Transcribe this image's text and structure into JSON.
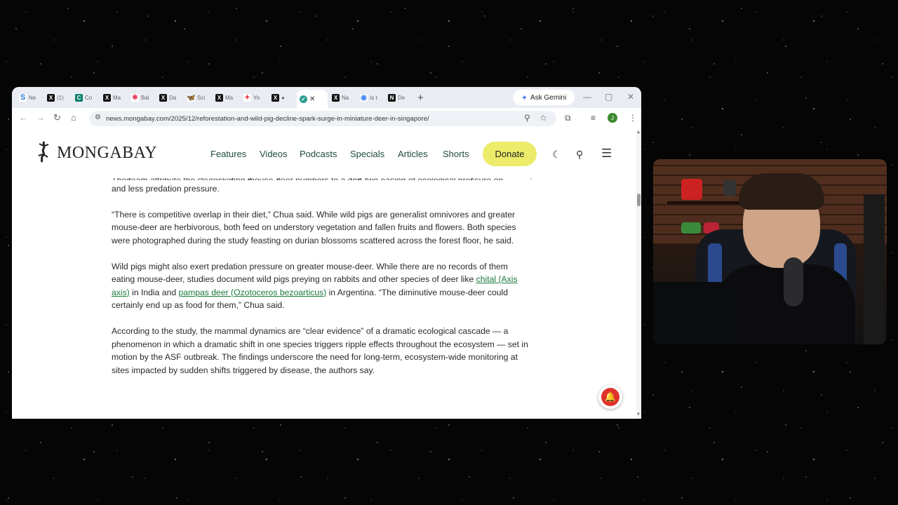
{
  "tabs": [
    {
      "icon": "s",
      "title": "Ne"
    },
    {
      "icon": "x",
      "title": "(1)"
    },
    {
      "icon": "c",
      "title": "Co"
    },
    {
      "icon": "x",
      "title": "Ma"
    },
    {
      "icon": "b",
      "title": "Bal"
    },
    {
      "icon": "x",
      "title": "Da"
    },
    {
      "icon": "bf",
      "title": "Sci"
    },
    {
      "icon": "x",
      "title": "Ma"
    },
    {
      "icon": "g",
      "title": "Yo"
    },
    {
      "icon": "x",
      "title": ""
    },
    {
      "icon": "m",
      "title": ""
    },
    {
      "icon": "x",
      "title": "Na"
    },
    {
      "icon": "ch",
      "title": "Is t"
    },
    {
      "icon": "n",
      "title": "De"
    }
  ],
  "browser": {
    "ask_gemini": "Ask Gemini",
    "url": "news.mongabay.com/2025/12/reforestation-and-wild-pig-decline-spark-surge-in-miniature-deer-in-singapore/",
    "profile_initial": "J"
  },
  "site": {
    "logo": "MONGABAY",
    "nav": [
      "Features",
      "Videos",
      "Podcasts",
      "Specials",
      "Articles",
      "Shorts"
    ],
    "donate": "Donate"
  },
  "article": {
    "cut_line": "The team attribute the skyrocketing mouse-deer numbers to a one-two easing of ecological pressure on",
    "p1": "the greater mouse-deer, the only ungulate species besides the pigs on the island: reduced competition for food, and less predation pressure.",
    "p2": "“There is competitive overlap in their diet,” Chua said. While wild pigs are generalist omnivores and greater mouse-deer are herbivorous, both feed on understory vegetation and fallen fruits and flowers. Both species were photographed during the study feasting on durian blossoms scattered across the forest floor, he said.",
    "p3_a": "Wild pigs might also exert predation pressure on greater mouse-deer. While there are no records of them eating mouse-deer, studies document wild pigs preying on rabbits and other species of deer like ",
    "p3_link1": "chital (Axis axis)",
    "p3_b": " in India and ",
    "p3_link2": "pampas deer (Ozotoceros bezoarticus)",
    "p3_c": " in Argentina. “The diminutive mouse-deer could certainly end up as food for them,” Chua said.",
    "p4": "According to the study, the mammal dynamics are “clear evidence” of a dramatic ecological cascade — a phenomenon in which a dramatic shift in one species triggers ripple effects throughout the ecosystem — set in motion by the ASF outbreak. The findings underscore the need for long-term, ecosystem-wide monitoring at sites impacted by sudden shifts triggered by disease, the authors say."
  },
  "colors": {
    "link": "#1b7a3d",
    "donate_bg": "#ecec6a",
    "nav_text": "#1f4a3c",
    "bell": "#e0322c"
  }
}
